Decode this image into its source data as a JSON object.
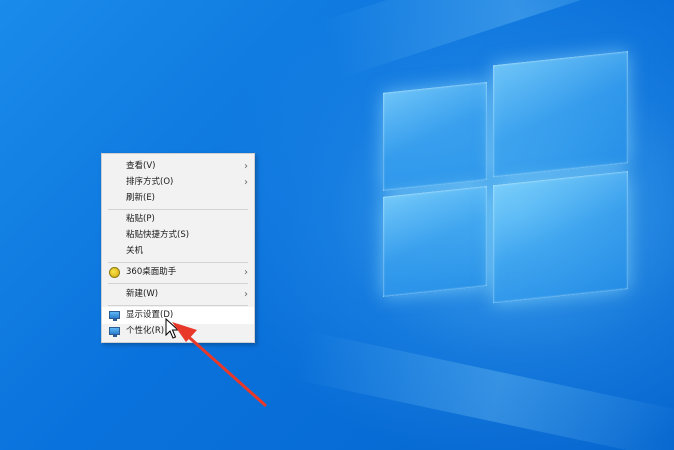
{
  "context_menu": {
    "items": [
      {
        "label": "查看(V)",
        "submenu": true
      },
      {
        "label": "排序方式(O)",
        "submenu": true
      },
      {
        "label": "刷新(E)",
        "submenu": false
      },
      {
        "label": "粘贴(P)",
        "submenu": false
      },
      {
        "label": "粘贴快捷方式(S)",
        "submenu": false
      },
      {
        "label": "关机",
        "submenu": false
      },
      {
        "label": "360桌面助手",
        "submenu": true,
        "icon": "360-icon"
      },
      {
        "label": "新建(W)",
        "submenu": true
      },
      {
        "label": "显示设置(D)",
        "submenu": false,
        "icon": "display-settings-icon",
        "highlighted": true
      },
      {
        "label": "个性化(R)",
        "submenu": false,
        "icon": "personalize-icon"
      }
    ],
    "chevron": "›"
  },
  "annotation": {
    "arrow_color": "#e8382a"
  },
  "colors": {
    "desktop_blue": "#0a6fd6",
    "menu_bg": "#f2f2f2"
  }
}
